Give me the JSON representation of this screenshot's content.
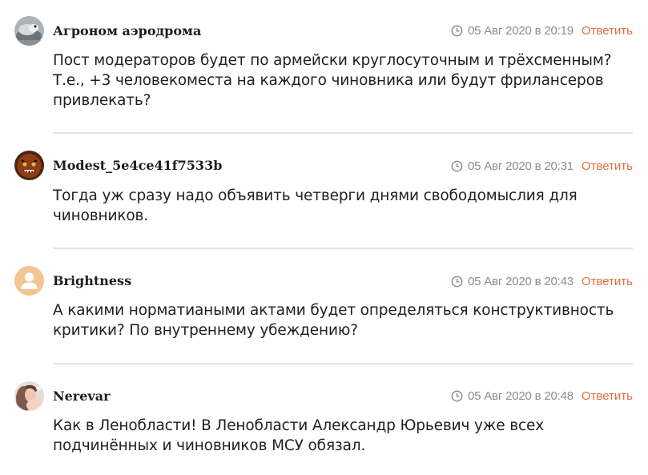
{
  "comments": [
    {
      "author": "Агроном аэродрома",
      "date": "05 Авг 2020 в 20:19",
      "reply_label": "Ответить",
      "text": "Пост модераторов будет по армейски круглосуточным и трёхсменным? Т.е., +3 человекоместа на каждого чиновника или будут фрилансеров привлекать?",
      "avatar": "grey-creature-avatar"
    },
    {
      "author": "Modest_5e4ce41f7533b",
      "date": "05 Авг 2020 в 20:31",
      "reply_label": "Ответить",
      "text": "Тогда уж сразу надо объявить четверги днями свободомыслия для чиновников.",
      "avatar": "angry-brown-creature-avatar"
    },
    {
      "author": "Brightness",
      "date": "05 Авг 2020 в 20:43",
      "reply_label": "Ответить",
      "text": "А какими норматиаными актами будет определяться конструктивность критики? По внутреннему убеждению?",
      "avatar": "default-user-avatar"
    },
    {
      "author": "Nerevar",
      "date": "05 Авг 2020 в 20:48",
      "reply_label": "Ответить",
      "text": "Как в Ленобласти! В Ленобласти Александр Юрьевич уже всех подчинённых и чиновников МСУ обязал.",
      "avatar": "photo-avatar"
    }
  ],
  "colors": {
    "reply": "#e36d3f",
    "date": "#8c8c8c",
    "divider": "#e4e4e4",
    "default_avatar_bg": "#f3c494"
  }
}
